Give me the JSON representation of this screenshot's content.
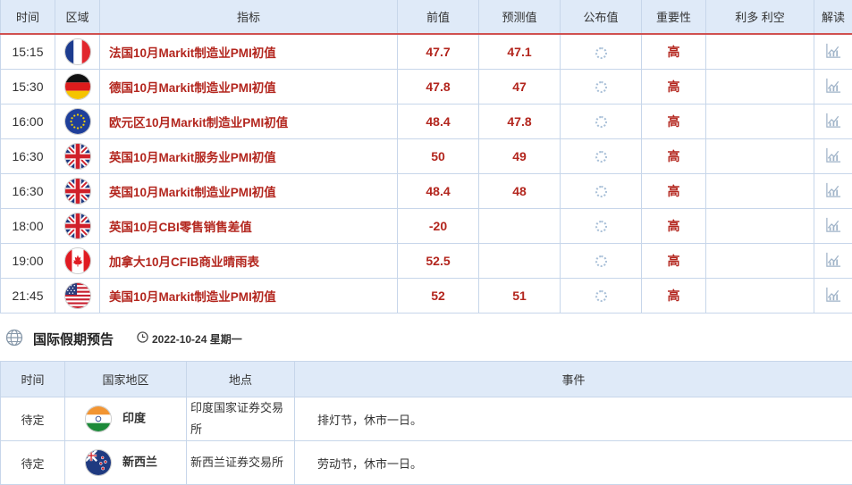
{
  "econ_table": {
    "headers": [
      "时间",
      "区域",
      "指标",
      "前值",
      "预测值",
      "公布值",
      "重要性",
      "利多 利空",
      "解读"
    ],
    "rows": [
      {
        "time": "15:15",
        "flag": "france-flag-icon",
        "indicator": "法国10月Markit制造业PMI初值",
        "previous": "47.7",
        "forecast": "47.1",
        "importance": "高"
      },
      {
        "time": "15:30",
        "flag": "germany-flag-icon",
        "indicator": "德国10月Markit制造业PMI初值",
        "previous": "47.8",
        "forecast": "47",
        "importance": "高"
      },
      {
        "time": "16:00",
        "flag": "eu-flag-icon",
        "indicator": "欧元区10月Markit制造业PMI初值",
        "previous": "48.4",
        "forecast": "47.8",
        "importance": "高"
      },
      {
        "time": "16:30",
        "flag": "uk-flag-icon",
        "indicator": "英国10月Markit服务业PMI初值",
        "previous": "50",
        "forecast": "49",
        "importance": "高"
      },
      {
        "time": "16:30",
        "flag": "uk-flag-icon",
        "indicator": "英国10月Markit制造业PMI初值",
        "previous": "48.4",
        "forecast": "48",
        "importance": "高"
      },
      {
        "time": "18:00",
        "flag": "uk-flag-icon",
        "indicator": "英国10月CBI零售销售差值",
        "previous": "-20",
        "forecast": "",
        "importance": "高"
      },
      {
        "time": "19:00",
        "flag": "canada-flag-icon",
        "indicator": "加拿大10月CFIB商业晴雨表",
        "previous": "52.5",
        "forecast": "",
        "importance": "高"
      },
      {
        "time": "21:45",
        "flag": "usa-flag-icon",
        "indicator": "美国10月Markit制造业PMI初值",
        "previous": "52",
        "forecast": "51",
        "importance": "高"
      }
    ]
  },
  "holiday": {
    "title": "国际假期预告",
    "date": "2022-10-24 星期一",
    "headers": [
      "时间",
      "国家地区",
      "地点",
      "事件"
    ],
    "rows": [
      {
        "time": "待定",
        "flag": "india-flag-icon",
        "region": "印度",
        "location": "印度国家证券交易所",
        "event": "排灯节，休市一日。"
      },
      {
        "time": "待定",
        "flag": "newzealand-flag-icon",
        "region": "新西兰",
        "location": "新西兰证券交易所",
        "event": "劳动节，休市一日。"
      }
    ]
  },
  "colors": {
    "header_bg": "#dfeaf8",
    "accent_red": "#b3261e",
    "border": "#c7d6ea"
  }
}
